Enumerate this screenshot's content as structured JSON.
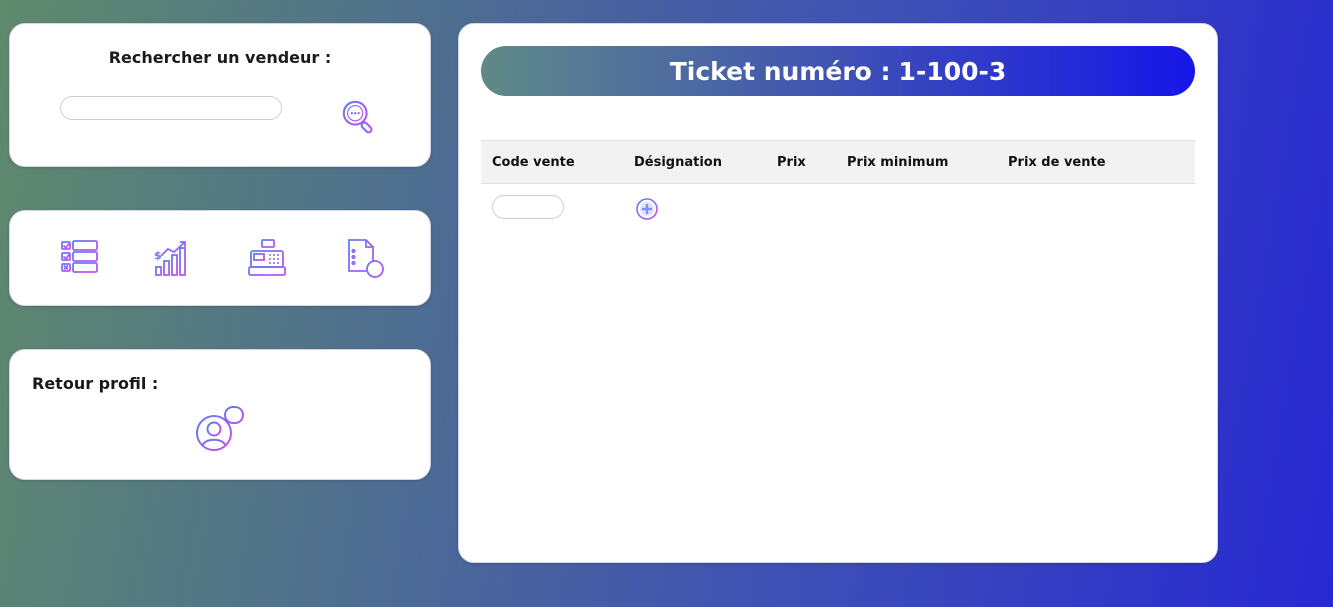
{
  "search": {
    "title": "Rechercher un vendeur :",
    "input_value": "",
    "input_placeholder": ""
  },
  "tools": {
    "items": [
      {
        "icon": "checklist-icon"
      },
      {
        "icon": "sales-chart-icon"
      },
      {
        "icon": "cash-register-icon"
      },
      {
        "icon": "add-document-icon"
      }
    ]
  },
  "profile": {
    "title": "Retour profil :",
    "icon": "user-profile-icon"
  },
  "ticket": {
    "header_label": "Ticket numéro :",
    "header_number": "1-100-3",
    "columns": [
      "Code vente",
      "Désignation",
      "Prix",
      "Prix minimum",
      "Prix de vente"
    ],
    "code_input_value": "",
    "add_icon": "add-circle-icon"
  },
  "colors": {
    "icon_gradient_start": "#5b7ff0",
    "icon_gradient_end": "#c94ef0",
    "header_gradient_start": "#5f8a86",
    "header_gradient_end": "#1616e8"
  }
}
